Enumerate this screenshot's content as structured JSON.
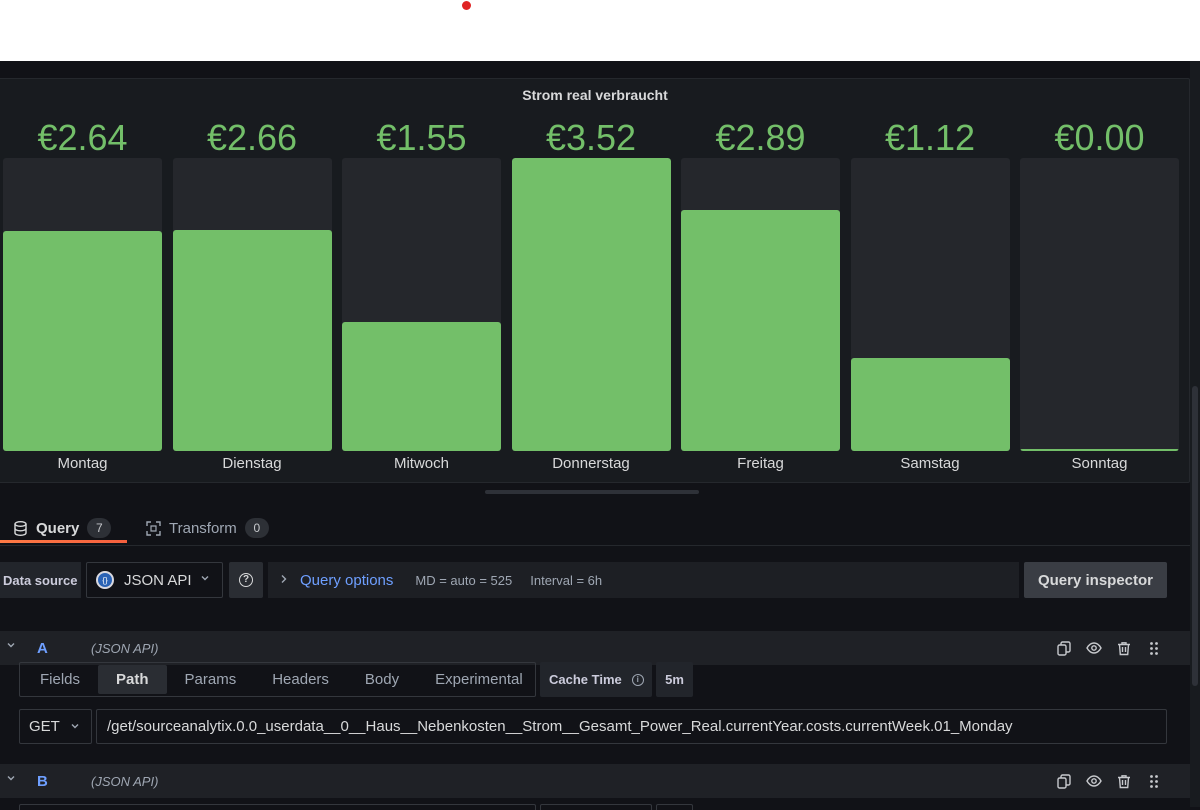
{
  "panel": {
    "title": "Strom real verbraucht",
    "gauges": [
      {
        "day": "Montag",
        "value_text": "€2.64",
        "value": 2.64
      },
      {
        "day": "Dienstag",
        "value_text": "€2.66",
        "value": 2.66
      },
      {
        "day": "Mitwoch",
        "value_text": "€1.55",
        "value": 1.55
      },
      {
        "day": "Donnerstag",
        "value_text": "€3.52",
        "value": 3.52
      },
      {
        "day": "Freitag",
        "value_text": "€2.89",
        "value": 2.89
      },
      {
        "day": "Samstag",
        "value_text": "€1.12",
        "value": 1.12
      },
      {
        "day": "Sonntag",
        "value_text": "€0.00",
        "value": 0.0
      }
    ],
    "max_value": 3.52,
    "bar_color": "#73bf69"
  },
  "tabs": {
    "query_label": "Query",
    "query_count": "7",
    "transform_label": "Transform",
    "transform_count": "0"
  },
  "datasource": {
    "label": "Data source",
    "name": "JSON API",
    "help_icon": "question-circle-icon"
  },
  "query_options": {
    "title": "Query options",
    "md": "MD = auto = 525",
    "interval": "Interval = 6h"
  },
  "query_inspector_label": "Query inspector",
  "queries": [
    {
      "name": "A",
      "datasource": "(JSON API)"
    },
    {
      "name": "B",
      "datasource": "(JSON API)"
    }
  ],
  "query_editor": {
    "tabs": [
      "Fields",
      "Path",
      "Params",
      "Headers",
      "Body",
      "Experimental"
    ],
    "active_tab": "Path",
    "cache_time_label": "Cache Time",
    "cache_time_value": "5m",
    "method": "GET",
    "path": "/get/sourceanalytix.0.0_userdata__0__Haus__Nebenkosten__Strom__Gesamt_Power_Real.currentYear.costs.currentWeek.01_Monday"
  },
  "colors": {
    "accent": "#6e9fff",
    "tab_underline": "#f55f3e",
    "gauge_green": "#73bf69"
  }
}
